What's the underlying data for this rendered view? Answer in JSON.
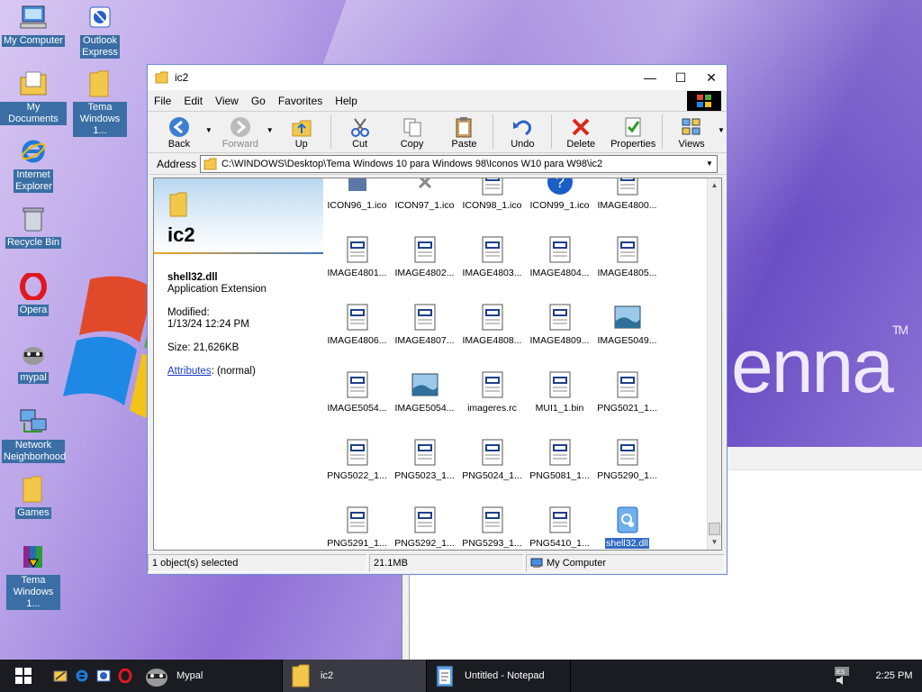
{
  "desktop": {
    "icons": [
      {
        "label": "My Computer",
        "icon": "my-computer-icon"
      },
      {
        "label": "Outlook Express",
        "icon": "outlook-express-icon"
      },
      {
        "label": "My Documents",
        "icon": "my-documents-icon"
      },
      {
        "label": "Tema Windows 1...",
        "icon": "folder-icon"
      },
      {
        "label": "Internet Explorer",
        "icon": "internet-explorer-icon"
      },
      {
        "label": "Recycle Bin",
        "icon": "recycle-bin-icon"
      },
      {
        "label": "Opera",
        "icon": "opera-icon"
      },
      {
        "label": "mypal",
        "icon": "mypal-icon"
      },
      {
        "label": "Network Neighborhood",
        "icon": "network-icon"
      },
      {
        "label": "Games",
        "icon": "folder-icon"
      },
      {
        "label": "Tema Windows 1...",
        "icon": "winrar-archive-icon"
      }
    ],
    "wallpaper_text": "enna",
    "wallpaper_tm": "TM"
  },
  "window": {
    "title": "ic2",
    "menu": [
      "File",
      "Edit",
      "View",
      "Go",
      "Favorites",
      "Help"
    ],
    "toolbar": {
      "back": "Back",
      "forward": "Forward",
      "up": "Up",
      "cut": "Cut",
      "copy": "Copy",
      "paste": "Paste",
      "undo": "Undo",
      "delete": "Delete",
      "properties": "Properties",
      "views": "Views"
    },
    "address": {
      "label": "Address",
      "path": "C:\\WINDOWS\\Desktop\\Tema Windows 10 para Windows 98\\Iconos W10 para W98\\ic2"
    },
    "left_pane": {
      "folder_name": "ic2",
      "file_name": "shell32.dll",
      "file_type": "Application Extension",
      "modified_label": "Modified:",
      "modified_value": "1/13/24 12:24 PM",
      "size_text": "Size: 21,626KB",
      "attributes_link": "Attributes",
      "attributes_value": ": (normal)"
    },
    "files": [
      [
        "ICON96_1.ico",
        "ICON97_1.ico",
        "ICON98_1.ico",
        "ICON99_1.ico",
        "IMAGE4800..."
      ],
      [
        "IMAGE4801...",
        "IMAGE4802...",
        "IMAGE4803...",
        "IMAGE4804...",
        "IMAGE4805..."
      ],
      [
        "IMAGE4806...",
        "IMAGE4807...",
        "IMAGE4808...",
        "IMAGE4809...",
        "IMAGE5049..."
      ],
      [
        "IMAGE5054...",
        "IMAGE5054...",
        "imageres.rc",
        "MUI1_1.bin",
        "PNG5021_1..."
      ],
      [
        "PNG5022_1...",
        "PNG5023_1...",
        "PNG5024_1...",
        "PNG5081_1...",
        "PNG5290_1..."
      ],
      [
        "PNG5291_1...",
        "PNG5292_1...",
        "PNG5293_1...",
        "PNG5410_1...",
        "shell32.dll"
      ]
    ],
    "status": {
      "selection": "1 object(s) selected",
      "size": "21.1MB",
      "zone": "My Computer"
    }
  },
  "taskbar": {
    "tasks": [
      "Mypal",
      "ic2",
      "Untitled - Notepad"
    ],
    "clock": "2:25 PM"
  }
}
